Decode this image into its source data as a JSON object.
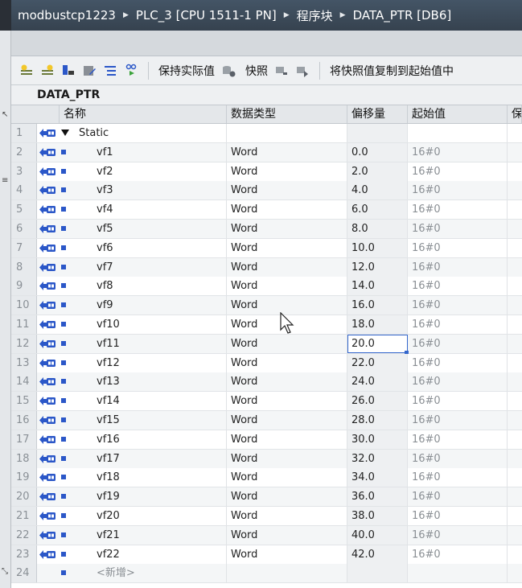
{
  "breadcrumb": {
    "project": "modbustcp1223",
    "device": "PLC_3 [CPU 1511-1 PN]",
    "folder": "程序块",
    "block": "DATA_PTR [DB6]"
  },
  "toolbar": {
    "keep_actual_label": "保持实际值",
    "snapshot_label": "快照",
    "copy_snapshot_label": "将快照值复制到起始值中"
  },
  "block_name": "DATA_PTR",
  "columns": {
    "name": "名称",
    "datatype": "数据类型",
    "offset": "偏移量",
    "start_value": "起始值",
    "retain": "保"
  },
  "static_row": {
    "num": "1",
    "name": "Static"
  },
  "rows": [
    {
      "num": "2",
      "name": "vf1",
      "type": "Word",
      "offset": "0.0",
      "start": "16#0"
    },
    {
      "num": "3",
      "name": "vf2",
      "type": "Word",
      "offset": "2.0",
      "start": "16#0"
    },
    {
      "num": "4",
      "name": "vf3",
      "type": "Word",
      "offset": "4.0",
      "start": "16#0"
    },
    {
      "num": "5",
      "name": "vf4",
      "type": "Word",
      "offset": "6.0",
      "start": "16#0"
    },
    {
      "num": "6",
      "name": "vf5",
      "type": "Word",
      "offset": "8.0",
      "start": "16#0"
    },
    {
      "num": "7",
      "name": "vf6",
      "type": "Word",
      "offset": "10.0",
      "start": "16#0"
    },
    {
      "num": "8",
      "name": "vf7",
      "type": "Word",
      "offset": "12.0",
      "start": "16#0"
    },
    {
      "num": "9",
      "name": "vf8",
      "type": "Word",
      "offset": "14.0",
      "start": "16#0"
    },
    {
      "num": "10",
      "name": "vf9",
      "type": "Word",
      "offset": "16.0",
      "start": "16#0"
    },
    {
      "num": "11",
      "name": "vf10",
      "type": "Word",
      "offset": "18.0",
      "start": "16#0"
    },
    {
      "num": "12",
      "name": "vf11",
      "type": "Word",
      "offset": "20.0",
      "start": "16#0"
    },
    {
      "num": "13",
      "name": "vf12",
      "type": "Word",
      "offset": "22.0",
      "start": "16#0"
    },
    {
      "num": "14",
      "name": "vf13",
      "type": "Word",
      "offset": "24.0",
      "start": "16#0"
    },
    {
      "num": "15",
      "name": "vf14",
      "type": "Word",
      "offset": "26.0",
      "start": "16#0"
    },
    {
      "num": "16",
      "name": "vf15",
      "type": "Word",
      "offset": "28.0",
      "start": "16#0"
    },
    {
      "num": "17",
      "name": "vf16",
      "type": "Word",
      "offset": "30.0",
      "start": "16#0"
    },
    {
      "num": "18",
      "name": "vf17",
      "type": "Word",
      "offset": "32.0",
      "start": "16#0"
    },
    {
      "num": "19",
      "name": "vf18",
      "type": "Word",
      "offset": "34.0",
      "start": "16#0"
    },
    {
      "num": "20",
      "name": "vf19",
      "type": "Word",
      "offset": "36.0",
      "start": "16#0"
    },
    {
      "num": "21",
      "name": "vf20",
      "type": "Word",
      "offset": "38.0",
      "start": "16#0"
    },
    {
      "num": "22",
      "name": "vf21",
      "type": "Word",
      "offset": "40.0",
      "start": "16#0"
    },
    {
      "num": "23",
      "name": "vf22",
      "type": "Word",
      "offset": "42.0",
      "start": "16#0"
    }
  ],
  "new_row": {
    "num": "24",
    "name": "<新增>"
  },
  "selected_row_num": "12",
  "colors": {
    "title_bg": "#3e4b59",
    "accent_blue": "#2b57c8",
    "selection": "#3366cc"
  },
  "icons": {
    "db_member": "db-member-icon",
    "member_bullet": "blue-square-icon"
  }
}
